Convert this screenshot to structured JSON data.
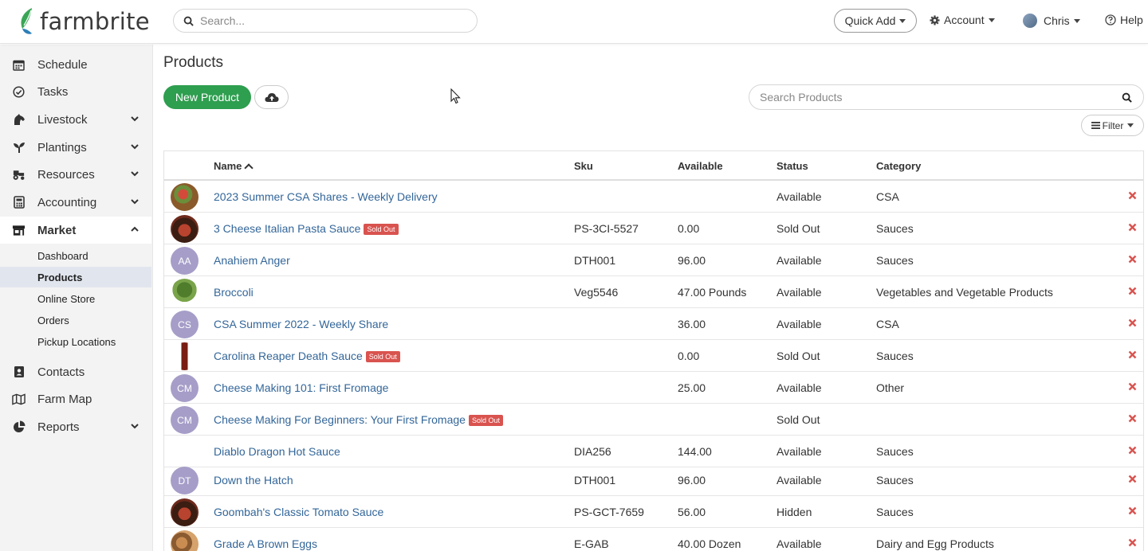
{
  "brand": {
    "name": "farmbrite",
    "accent": "#2e9e4f",
    "danger": "#d9534f",
    "link": "#336699"
  },
  "header": {
    "search_placeholder": "Search...",
    "quick_add": "Quick Add",
    "account": "Account",
    "user": "Chris",
    "help": "Help"
  },
  "sidebar": {
    "items": [
      {
        "label": "Schedule",
        "icon": "calendar-icon"
      },
      {
        "label": "Tasks",
        "icon": "check-circle-icon"
      },
      {
        "label": "Livestock",
        "icon": "horse-icon"
      },
      {
        "label": "Plantings",
        "icon": "seedling-icon"
      },
      {
        "label": "Resources",
        "icon": "tractor-icon"
      },
      {
        "label": "Accounting",
        "icon": "calculator-icon"
      },
      {
        "label": "Market",
        "icon": "store-icon"
      },
      {
        "label": "Contacts",
        "icon": "address-book-icon"
      },
      {
        "label": "Farm Map",
        "icon": "map-icon"
      },
      {
        "label": "Reports",
        "icon": "pie-chart-icon"
      }
    ],
    "market_sub": [
      "Dashboard",
      "Products",
      "Online Store",
      "Orders",
      "Pickup Locations"
    ],
    "current_sub": "Products"
  },
  "page": {
    "title": "Products",
    "new_product": "New Product",
    "search_placeholder": "Search Products",
    "filter": "Filter"
  },
  "table": {
    "columns": [
      "Name",
      "Sku",
      "Available",
      "Status",
      "Category"
    ],
    "sold_out_badge": "Sold Out",
    "rows": [
      {
        "name": "2023 Summer CSA Shares - Weekly Delivery",
        "sku": "",
        "available": "",
        "status": "Available",
        "category": "CSA",
        "thumb": "photo-basket",
        "sold_out": false
      },
      {
        "name": "3 Cheese Italian Pasta Sauce",
        "sku": "PS-3CI-5527",
        "available": "0.00",
        "status": "Sold Out",
        "category": "Sauces",
        "thumb": "photo-sauce",
        "sold_out": true
      },
      {
        "name": "Anahiem Anger",
        "sku": "DTH001",
        "available": "96.00",
        "status": "Available",
        "category": "Sauces",
        "thumb": "AA",
        "sold_out": false
      },
      {
        "name": "Broccoli",
        "sku": "Veg5546",
        "available": "47.00 Pounds",
        "status": "Available",
        "category": "Vegetables and Vegetable Products",
        "thumb": "photo-broccoli",
        "sold_out": false
      },
      {
        "name": "CSA Summer 2022 - Weekly Share",
        "sku": "",
        "available": "36.00",
        "status": "Available",
        "category": "CSA",
        "thumb": "CS",
        "sold_out": false
      },
      {
        "name": "Carolina Reaper Death Sauce",
        "sku": "",
        "available": "0.00",
        "status": "Sold Out",
        "category": "Sauces",
        "thumb": "photo-bottle",
        "sold_out": true
      },
      {
        "name": "Cheese Making 101: First Fromage",
        "sku": "",
        "available": "25.00",
        "status": "Available",
        "category": "Other",
        "thumb": "CM",
        "sold_out": false
      },
      {
        "name": "Cheese Making For Beginners: Your First Fromage",
        "sku": "",
        "available": "",
        "status": "Sold Out",
        "category": "",
        "thumb": "CM",
        "sold_out": true
      },
      {
        "name": "Diablo Dragon Hot Sauce",
        "sku": "DIA256",
        "available": "144.00",
        "status": "Available",
        "category": "Sauces",
        "thumb": "",
        "sold_out": false
      },
      {
        "name": "Down the Hatch",
        "sku": "DTH001",
        "available": "96.00",
        "status": "Available",
        "category": "Sauces",
        "thumb": "DT",
        "sold_out": false
      },
      {
        "name": "Goombah's Classic Tomato Sauce",
        "sku": "PS-GCT-7659",
        "available": "56.00",
        "status": "Hidden",
        "category": "Sauces",
        "thumb": "photo-sauce",
        "sold_out": false
      },
      {
        "name": "Grade A Brown Eggs",
        "sku": "E-GAB",
        "available": "40.00 Dozen",
        "status": "Available",
        "category": "Dairy and Egg Products",
        "thumb": "photo-eggs",
        "sold_out": false
      }
    ]
  }
}
